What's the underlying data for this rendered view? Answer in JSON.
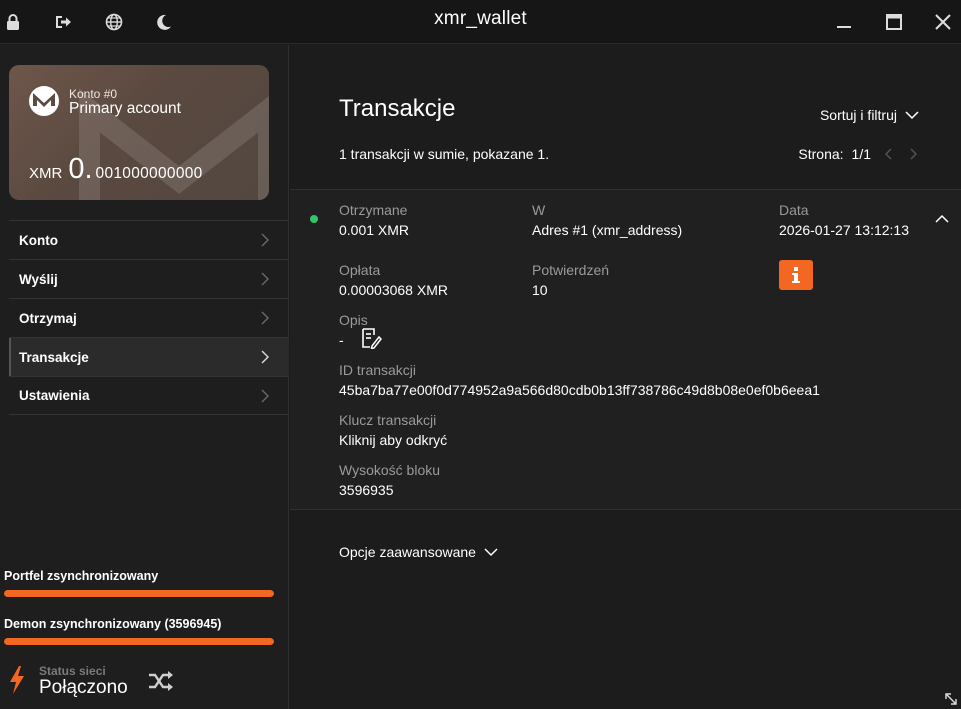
{
  "window": {
    "title": "xmr_wallet",
    "icons": [
      "lock-icon",
      "logout-icon",
      "globe-icon",
      "moon-icon"
    ],
    "controls": [
      "minimize-icon",
      "maximize-icon",
      "close-icon"
    ]
  },
  "account_card": {
    "account_number": "Konto #0",
    "account_name": "Primary account",
    "currency": "XMR",
    "balance_integer": "0.",
    "balance_fraction": "001000000000"
  },
  "menu": {
    "items": [
      {
        "label": "Konto",
        "active": false
      },
      {
        "label": "Wyślij",
        "active": false
      },
      {
        "label": "Otrzymaj",
        "active": false
      },
      {
        "label": "Transakcje",
        "active": true
      },
      {
        "label": "Ustawienia",
        "active": false
      }
    ]
  },
  "sync": {
    "wallet_label": "Portfel zsynchronizowany",
    "wallet_progress": 1.0,
    "daemon_label": "Demon zsynchronizowany (3596945)",
    "daemon_progress": 1.0
  },
  "network": {
    "label": "Status sieci",
    "value": "Połączono"
  },
  "transactions": {
    "title": "Transakcje",
    "sort_label": "Sortuj i filtruj",
    "summary": "1 transakcji w sumie, pokazane 1.",
    "page_label": "Strona:",
    "page_value": "1/1",
    "item": {
      "direction_label": "Otrzymane",
      "amount": "0.001 XMR",
      "in_label": "W",
      "in_value": "Adres #1 (xmr_address)",
      "date_label": "Data",
      "date_value": "2026-01-27 13:12:13",
      "fee_label": "Opłata",
      "fee_value": "0.00003068 XMR",
      "confirmations_label": "Potwierdzeń",
      "confirmations_value": "10",
      "description_label": "Opis",
      "description_value": "-",
      "txid_label": "ID transakcji",
      "txid_value": "45ba7ba77e00f0d774952a9a566d80cdb0b13ff738786c49d8b08e0ef0b6eea1",
      "txkey_label": "Klucz transakcji",
      "txkey_value": "Kliknij aby odkryć",
      "height_label": "Wysokość bloku",
      "height_value": "3596935",
      "status_color": "#2fc76a"
    },
    "advanced_label": "Opcje zaawansowane"
  },
  "colors": {
    "accent": "#f26822",
    "background": "#1c1c1c",
    "muted_text": "#9a9a9a"
  }
}
